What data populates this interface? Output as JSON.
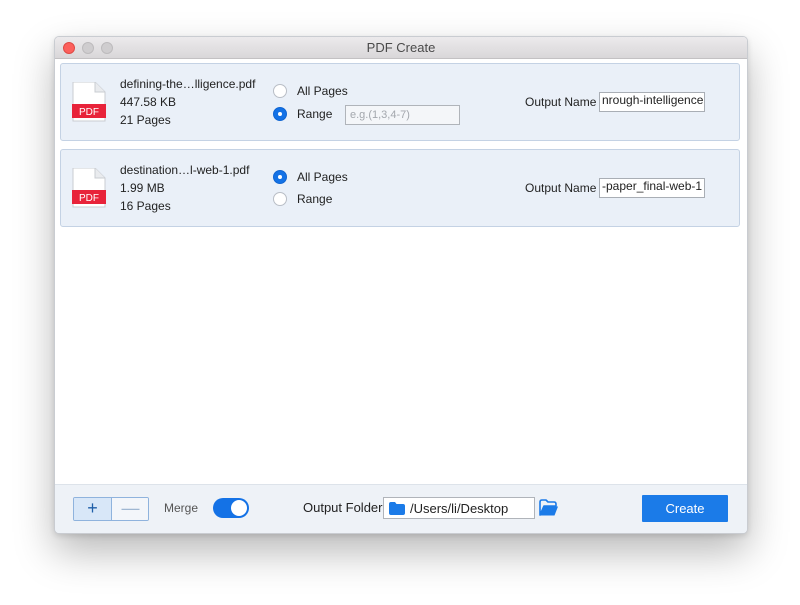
{
  "window": {
    "title": "PDF Create"
  },
  "files": [
    {
      "name": "defining-the…lligence.pdf",
      "size": "447.58 KB",
      "pages": "21 Pages",
      "icon_label": "PDF",
      "option_all": "All Pages",
      "option_range": "Range",
      "selected": "range",
      "range_placeholder": "e.g.(1,3,4-7)",
      "output_label": "Output Name",
      "output_value": "nrough-intelligence"
    },
    {
      "name": "destination…l-web-1.pdf",
      "size": "1.99 MB",
      "pages": "16 Pages",
      "icon_label": "PDF",
      "option_all": "All Pages",
      "option_range": "Range",
      "selected": "all",
      "output_label": "Output Name",
      "output_value": "-paper_final-web-1"
    }
  ],
  "bottom": {
    "add_symbol": "+",
    "remove_symbol": "—",
    "merge_label": "Merge",
    "merge_on": true,
    "folder_label": "Output Folder",
    "folder_path": "/Users/li/Desktop",
    "create_label": "Create"
  },
  "colors": {
    "accent": "#1b7be8",
    "pdf_red": "#e8233a",
    "row_bg": "#eaf0f8"
  },
  "icons": {
    "file": "pdf-file-icon",
    "folder": "folder-icon",
    "browse": "open-folder-icon"
  }
}
